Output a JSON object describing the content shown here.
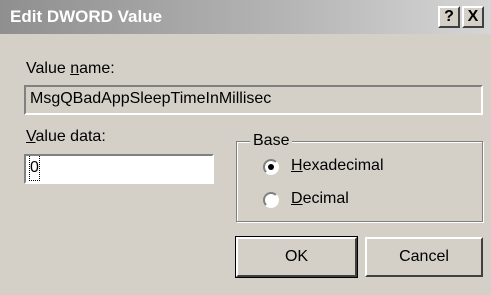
{
  "window": {
    "title": "Edit DWORD Value",
    "help_label": "?",
    "close_label": "X"
  },
  "value_name": {
    "label_prefix": "Value ",
    "label_access": "n",
    "label_suffix": "ame:",
    "value": "MsgQBadAppSleepTimeInMillisec"
  },
  "value_data": {
    "label_access": "V",
    "label_suffix": "alue data:",
    "value": "0"
  },
  "base": {
    "legend": "Base",
    "options": [
      {
        "access": "H",
        "rest": "exadecimal",
        "selected": true
      },
      {
        "access": "D",
        "rest": "ecimal",
        "selected": false
      }
    ]
  },
  "buttons": {
    "ok_label": "OK",
    "cancel_label": "Cancel"
  }
}
